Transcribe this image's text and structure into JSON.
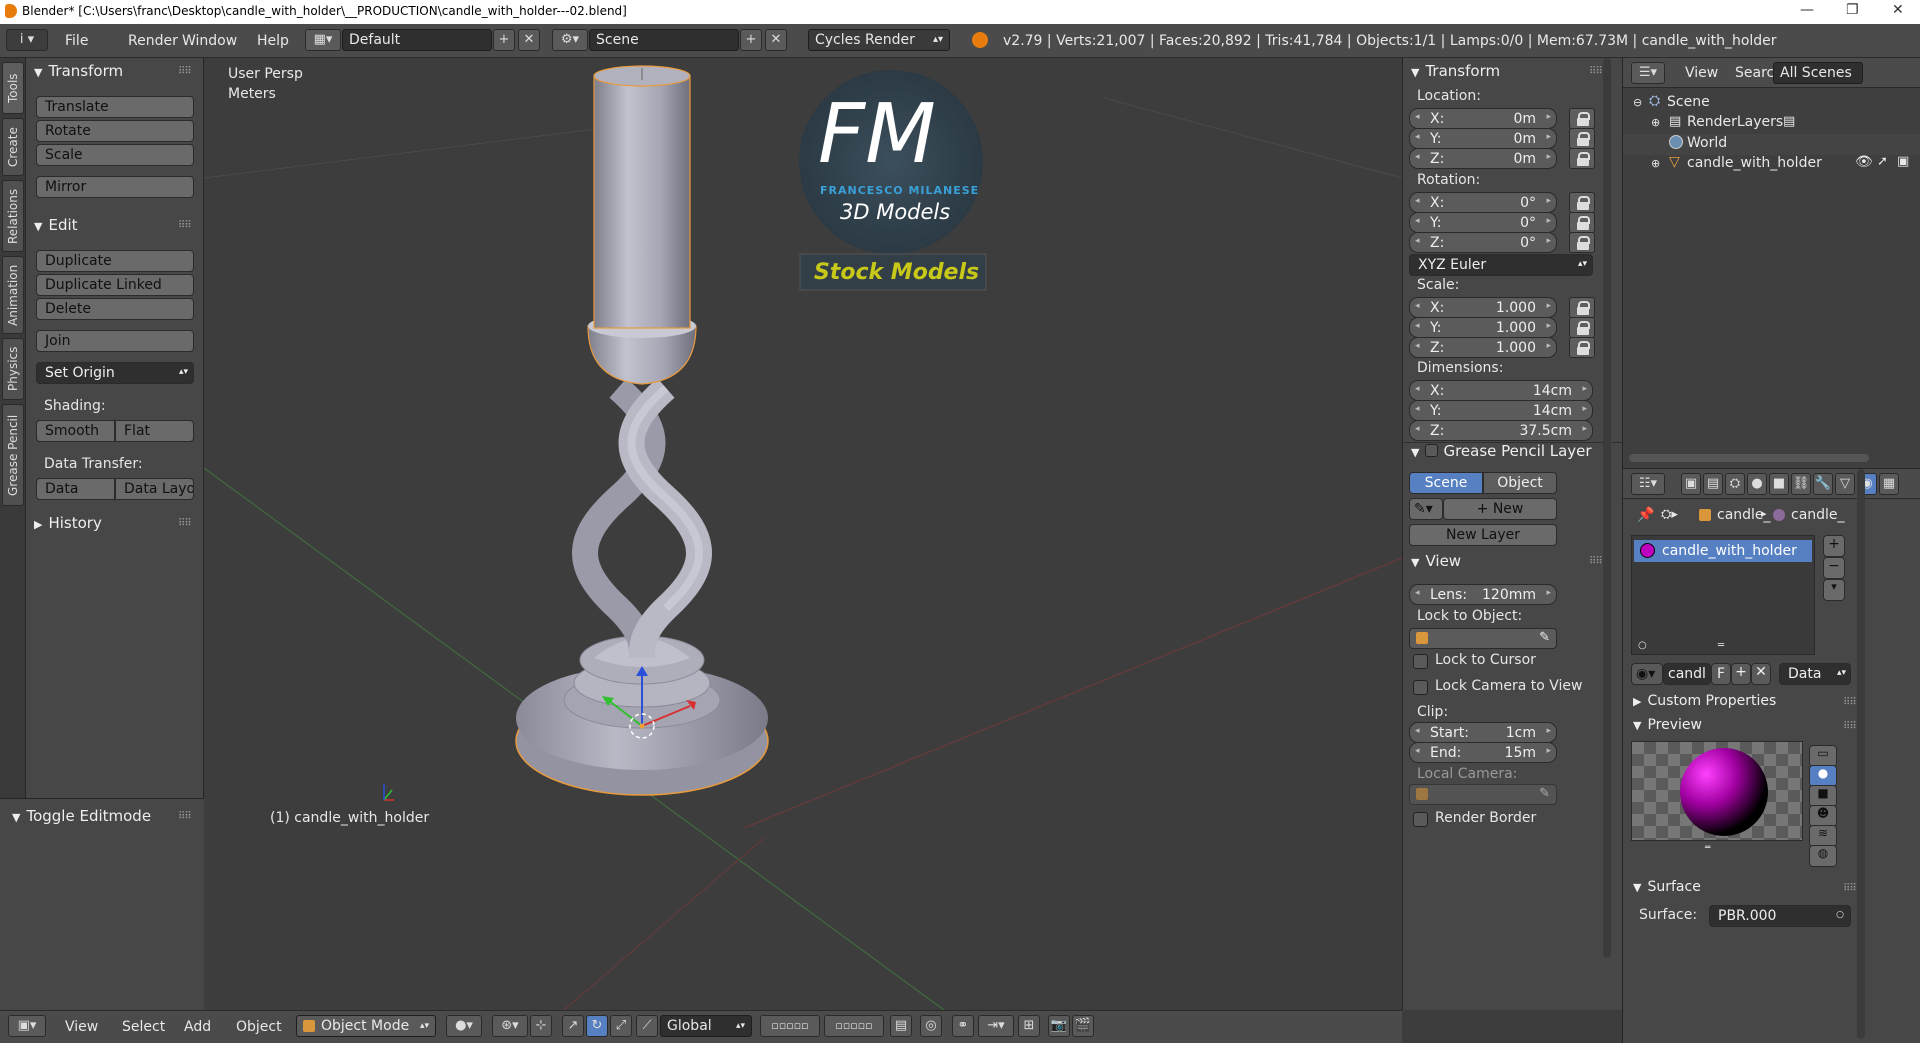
{
  "window": {
    "title": "Blender* [C:\\Users\\franc\\Desktop\\candle_with_holder\\__PRODUCTION\\candle_with_holder---02.blend]",
    "minimize": "—",
    "maximize": "❐",
    "close": "✕"
  },
  "top_menu": {
    "info_icon": "i",
    "items": [
      "File",
      "Render",
      "Window",
      "Help"
    ],
    "screen_layout": "Default",
    "scene": "Scene",
    "render_engine": "Cycles Render",
    "stats": "v2.79 | Verts:21,007 | Faces:20,892 | Tris:41,784 | Objects:1/1 | Lamps:0/0 | Mem:67.73M | candle_with_holder"
  },
  "side_tabs": [
    "Tools",
    "Create",
    "Relations",
    "Animation",
    "Physics",
    "Grease Pencil"
  ],
  "toolshelf": {
    "transform_header": "Transform",
    "translate": "Translate",
    "rotate": "Rotate",
    "scale": "Scale",
    "mirror": "Mirror",
    "edit_header": "Edit",
    "duplicate": "Duplicate",
    "duplicate_linked": "Duplicate Linked",
    "delete": "Delete",
    "join": "Join",
    "set_origin": "Set Origin",
    "shading_label": "Shading:",
    "smooth": "Smooth",
    "flat": "Flat",
    "data_transfer_label": "Data Transfer:",
    "data": "Data",
    "data_layout": "Data Layo",
    "history_header": "History",
    "toggle_editmode": "Toggle Editmode"
  },
  "viewport": {
    "view_label": "User Persp",
    "units_label": "Meters",
    "object_label": "(1) candle_with_holder",
    "logo_letters": "FM",
    "logo_name": "FRANCESCO MILANESE",
    "logo_sub": "3D Models",
    "stock_label": "Stock Models"
  },
  "npanel": {
    "transform_header": "Transform",
    "location_label": "Location:",
    "location": {
      "x": "0m",
      "y": "0m",
      "z": "0m"
    },
    "rotation_label": "Rotation:",
    "rotation": {
      "x": "0°",
      "y": "0°",
      "z": "0°"
    },
    "rotation_mode": "XYZ Euler",
    "scale_label": "Scale:",
    "scale": {
      "x": "1.000",
      "y": "1.000",
      "z": "1.000"
    },
    "dimensions_label": "Dimensions:",
    "dimensions": {
      "x": "14cm",
      "y": "14cm",
      "z": "37.5cm"
    },
    "axis": {
      "x": "X:",
      "y": "Y:",
      "z": "Z:"
    },
    "grease_header": "Grease Pencil Layer",
    "scene_tab": "Scene",
    "object_tab": "Object",
    "new_btn": "New",
    "new_layer_btn": "New Layer",
    "view_header": "View",
    "lens_label": "Lens:",
    "lens_value": "120mm",
    "lock_to_object_label": "Lock to Object:",
    "lock_to_cursor": "Lock to Cursor",
    "lock_camera": "Lock Camera to View",
    "clip_label": "Clip:",
    "clip_start_label": "Start:",
    "clip_start": "1cm",
    "clip_end_label": "End:",
    "clip_end": "15m",
    "local_camera_label": "Local Camera:",
    "render_border": "Render Border"
  },
  "outliner": {
    "view": "View",
    "search": "Search",
    "filter": "All Scenes",
    "items": [
      "Scene",
      "RenderLayers",
      "World",
      "candle_with_holder"
    ]
  },
  "properties": {
    "breadcrumb": [
      "candle_",
      "candle_"
    ],
    "material_slot": "candle_with_holder",
    "material_name": "candl",
    "fake_user": "F",
    "link_mode": "Data",
    "custom_properties": "Custom Properties",
    "preview": "Preview",
    "surface_header": "Surface",
    "surface_label": "Surface:",
    "surface_value": "PBR.000"
  },
  "bottom_bar": {
    "menu": [
      "View",
      "Select",
      "Add",
      "Object"
    ],
    "mode": "Object Mode",
    "orientation": "Global"
  },
  "colors": {
    "accent_blue": "#5680c2",
    "selected_orange": "#e89a3c",
    "logo_blue": "#3aa0d8",
    "stock_yellow": "#c8c818"
  }
}
